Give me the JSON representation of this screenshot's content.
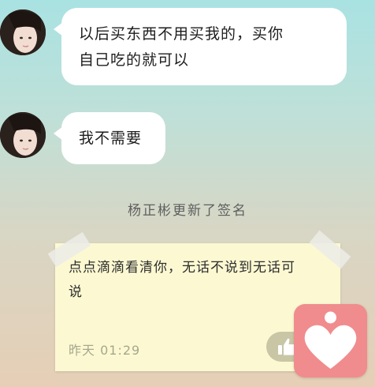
{
  "messages": [
    {
      "text_line1": "以后买东西不用买我的，买你",
      "text_line2": "自己吃的就可以"
    },
    {
      "text": "我不需要"
    }
  ],
  "system_note": "杨正彬更新了签名",
  "signature_card": {
    "text_line1": "点点滴滴看清你，无话不说到无话可",
    "text_line2": "说",
    "time": "昨天 01:29"
  },
  "icons": {
    "avatar": "avatar-girl",
    "like": "thumbs-up-icon",
    "favorite": "heart-person-icon"
  },
  "colors": {
    "bubble": "#ffffff",
    "card": "#fcf9d2",
    "badge": "#f08c8e"
  }
}
